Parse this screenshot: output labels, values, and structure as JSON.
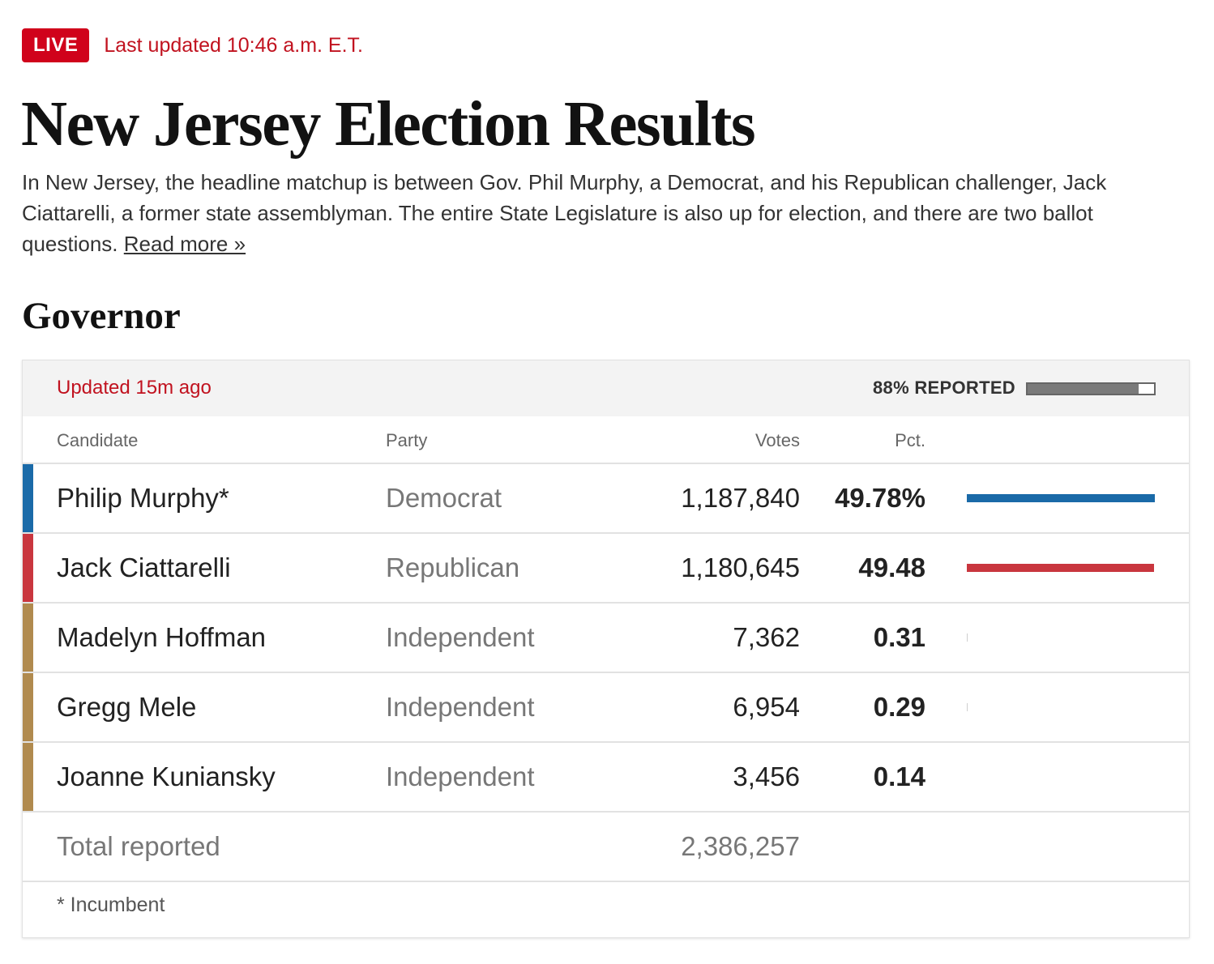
{
  "header": {
    "live_badge": "LIVE",
    "last_updated": "Last updated 10:46 a.m. E.T.",
    "title": "New Jersey Election Results",
    "intro": "In New Jersey, the headline matchup is between Gov. Phil Murphy, a Democrat, and his Republican challenger, Jack Ciattarelli, a former state assemblyman. The entire State Legislature is also up for election, and there are two ballot questions.",
    "read_more": "Read more »"
  },
  "race": {
    "title": "Governor",
    "updated": "Updated 15m ago",
    "reported_label": "88% REPORTED",
    "reported_fraction": 0.88,
    "columns": {
      "candidate": "Candidate",
      "party": "Party",
      "votes": "Votes",
      "pct": "Pct."
    },
    "candidates": [
      {
        "name": "Philip Murphy*",
        "party": "Democrat",
        "votes": "1,187,840",
        "pct": "49.78%",
        "pct_value": 49.78,
        "color": "#1a6aa8"
      },
      {
        "name": "Jack Ciattarelli",
        "party": "Republican",
        "votes": "1,180,645",
        "pct": "49.48",
        "pct_value": 49.48,
        "color": "#c9363e"
      },
      {
        "name": "Madelyn Hoffman",
        "party": "Independent",
        "votes": "7,362",
        "pct": "0.31",
        "pct_value": 0.31,
        "color": "#b08a4e"
      },
      {
        "name": "Gregg Mele",
        "party": "Independent",
        "votes": "6,954",
        "pct": "0.29",
        "pct_value": 0.29,
        "color": "#b08a4e"
      },
      {
        "name": "Joanne Kuniansky",
        "party": "Independent",
        "votes": "3,456",
        "pct": "0.14",
        "pct_value": 0.14,
        "color": "#b08a4e"
      }
    ],
    "total_label": "Total reported",
    "total_votes": "2,386,257",
    "footnote": "* Incumbent"
  }
}
